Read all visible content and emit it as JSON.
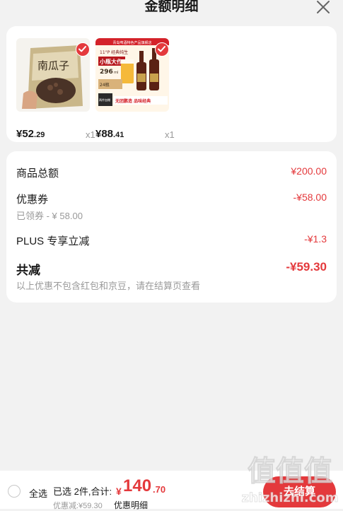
{
  "header": {
    "title": "金额明细",
    "close_icon": "close-icon"
  },
  "products": [
    {
      "name_on_pack": "南瓜子",
      "price_int": "¥52",
      "price_dec": ".29",
      "qty": "x1",
      "checked": true
    },
    {
      "banner": "青岛啤酒特色产品旗舰店",
      "tag": "11°P 经典纯生",
      "headline": "小瓶大作",
      "count": "296",
      "ml": "ml",
      "pack": "24瓶",
      "badge": "两件加赠",
      "slogan": "无团鹏造 品味经典",
      "price_int": "¥88",
      "price_dec": ".41",
      "qty": "x1",
      "checked": true
    }
  ],
  "summary": {
    "goods_total_label": "商品总额",
    "goods_total_value": "¥200.00",
    "coupon_label": "优惠券",
    "coupon_value": "-¥58.00",
    "coupon_sub": "已领券 - ¥ 58.00",
    "plus_label": "PLUS 专享立减",
    "plus_value": "-¥1.3",
    "total_discount_label": "共减",
    "total_discount_value": "-¥59.30",
    "note": "以上优惠不包含红包和京豆，请在结算页查看"
  },
  "bottom_bar": {
    "select_all": "全选",
    "selected_text": "已选 2件,合计:",
    "currency": "¥",
    "total_int": "140",
    "total_dec": ".70",
    "discount_line": "优惠减:¥59.30",
    "detail_link": "优惠明细",
    "checkout": "去结算"
  },
  "watermark": {
    "line1": "值值值",
    "line2": "zhizhizhi.com"
  },
  "colors": {
    "accent": "#e4393c",
    "background": "#f2f2f2",
    "muted": "#999999"
  }
}
